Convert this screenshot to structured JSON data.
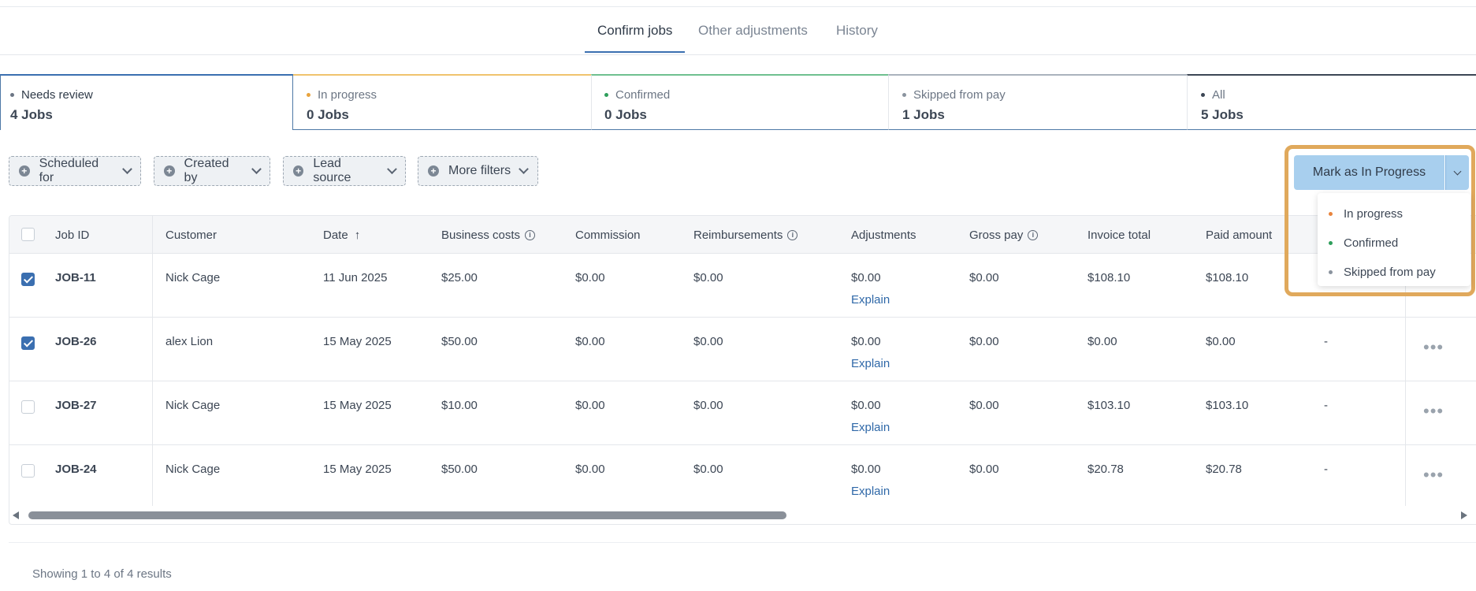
{
  "tabs": [
    {
      "label": "Confirm jobs"
    },
    {
      "label": "Other adjustments"
    },
    {
      "label": "History"
    }
  ],
  "cards": [
    {
      "label": "Needs review",
      "count": "4 Jobs",
      "color": "#6c7684"
    },
    {
      "label": "In progress",
      "count": "0 Jobs",
      "color": "#e8a33d"
    },
    {
      "label": "Confirmed",
      "count": "0 Jobs",
      "color": "#2e9e5b"
    },
    {
      "label": "Skipped from pay",
      "count": "1 Jobs",
      "color": "#8a939e"
    },
    {
      "label": "All",
      "count": "5 Jobs",
      "color": "#3c4654"
    }
  ],
  "filters": [
    {
      "label": "Scheduled for"
    },
    {
      "label": "Created by"
    },
    {
      "label": "Lead source"
    },
    {
      "label": "More filters"
    }
  ],
  "action": {
    "label": "Mark as In Progress",
    "menu": [
      {
        "label": "In progress",
        "color": "#e8843d"
      },
      {
        "label": "Confirmed",
        "color": "#2e9e5b"
      },
      {
        "label": "Skipped from pay",
        "color": "#8a939e"
      }
    ]
  },
  "table": {
    "headers": {
      "job_id": "Job ID",
      "customer": "Customer",
      "date": "Date",
      "date_sort": "↑",
      "business_costs": "Business costs",
      "commission": "Commission",
      "reimbursements": "Reimbursements",
      "adjustments": "Adjustments",
      "gross_pay": "Gross pay",
      "invoice_total": "Invoice total",
      "paid_amount": "Paid amount",
      "info_glyph": "i"
    },
    "explain_label": "Explain",
    "rows": [
      {
        "job_id": "JOB-11",
        "customer": "Nick Cage",
        "date": "11 Jun 2025",
        "business_costs": "$25.00",
        "commission": "$0.00",
        "reimbursements": "$0.00",
        "adjustments": "$0.00",
        "gross_pay": "$0.00",
        "invoice_total": "$108.10",
        "paid_amount": "$108.10",
        "extra": "",
        "checked": true
      },
      {
        "job_id": "JOB-26",
        "customer": "alex Lion",
        "date": "15 May 2025",
        "business_costs": "$50.00",
        "commission": "$0.00",
        "reimbursements": "$0.00",
        "adjustments": "$0.00",
        "gross_pay": "$0.00",
        "invoice_total": "$0.00",
        "paid_amount": "$0.00",
        "extra": "-",
        "checked": true
      },
      {
        "job_id": "JOB-27",
        "customer": "Nick Cage",
        "date": "15 May 2025",
        "business_costs": "$10.00",
        "commission": "$0.00",
        "reimbursements": "$0.00",
        "adjustments": "$0.00",
        "gross_pay": "$0.00",
        "invoice_total": "$103.10",
        "paid_amount": "$103.10",
        "extra": "-",
        "checked": false
      },
      {
        "job_id": "JOB-24",
        "customer": "Nick Cage",
        "date": "15 May 2025",
        "business_costs": "$50.00",
        "commission": "$0.00",
        "reimbursements": "$0.00",
        "adjustments": "$0.00",
        "gross_pay": "$0.00",
        "invoice_total": "$20.78",
        "paid_amount": "$20.78",
        "extra": "-",
        "checked": false
      }
    ]
  },
  "footer": {
    "text": "Showing 1 to 4 of 4 results"
  }
}
